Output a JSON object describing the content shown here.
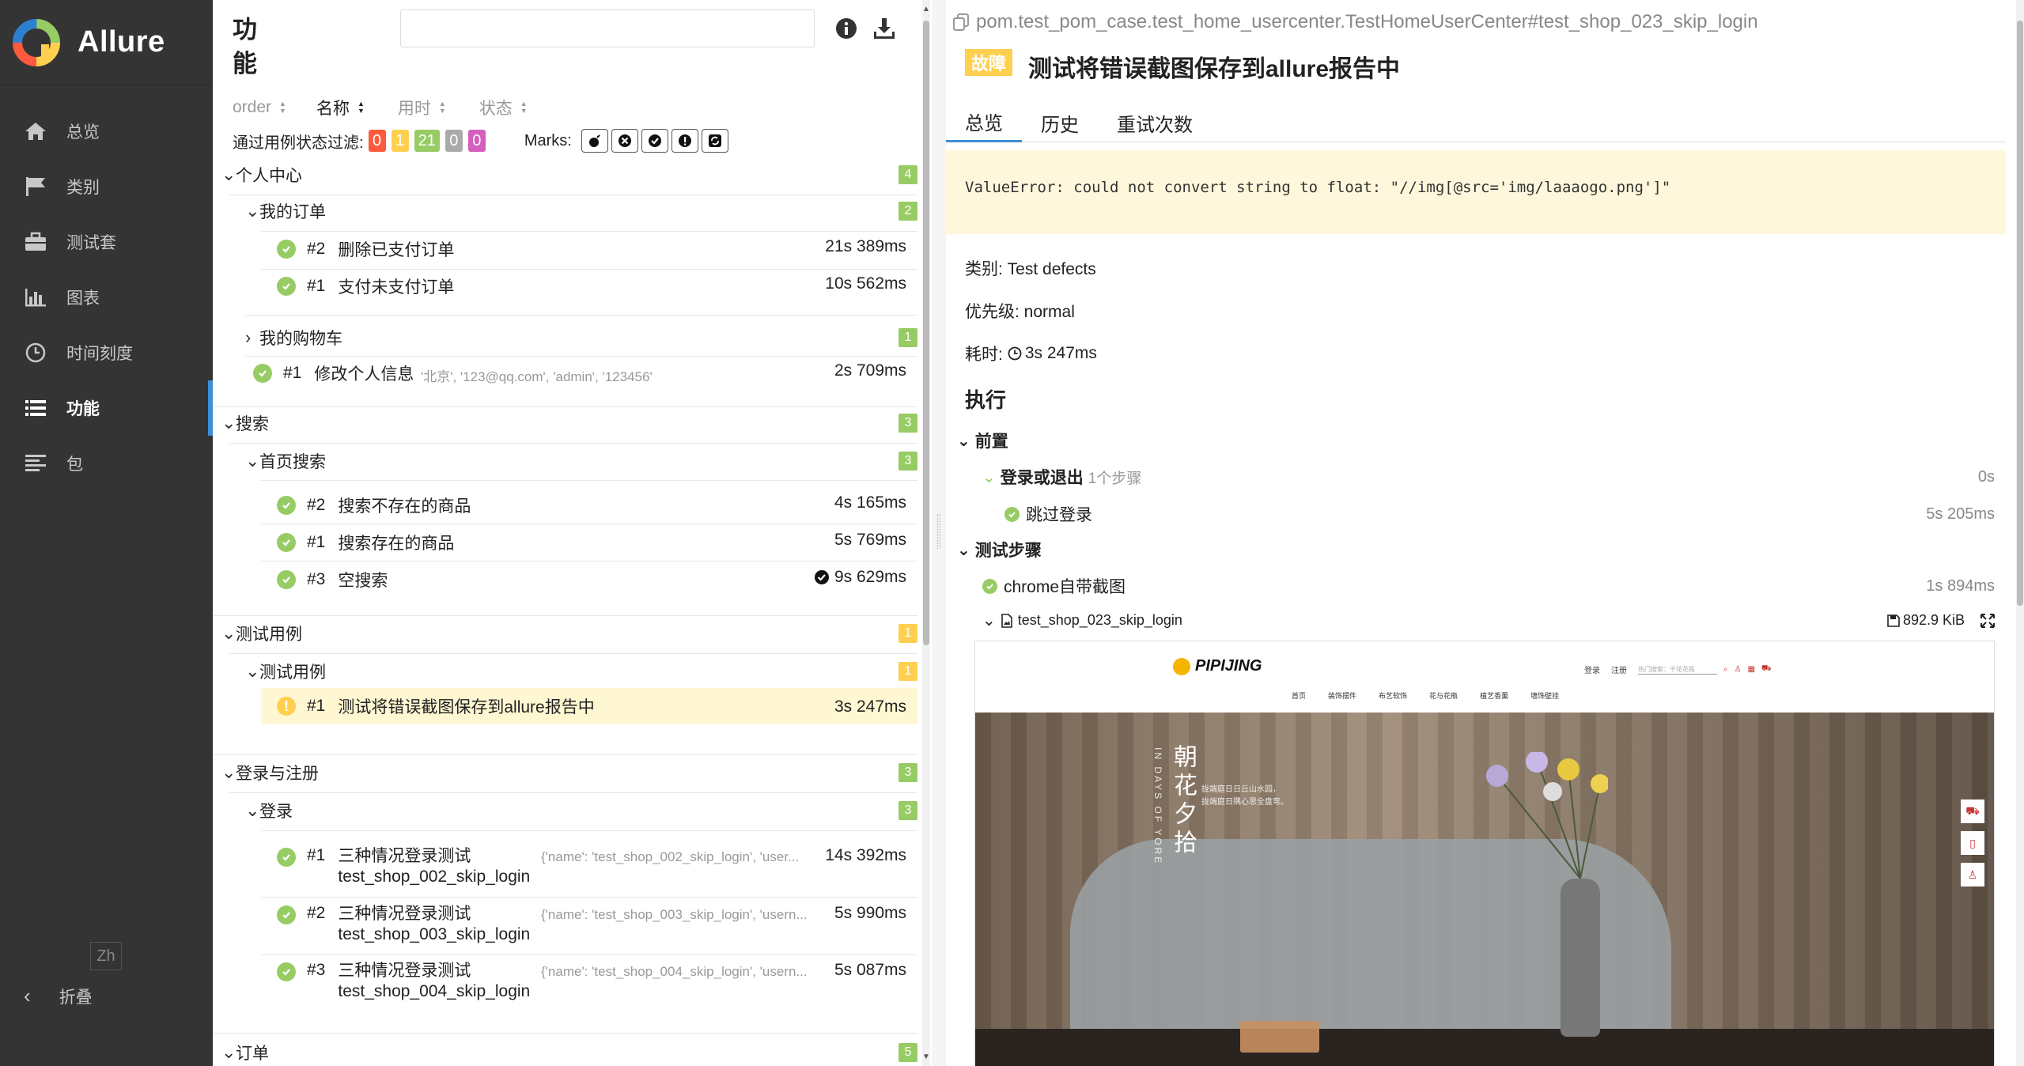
{
  "app": {
    "name": "Allure",
    "brand_colors": [
      "#97cc64",
      "#ffd050",
      "#fd5a3e",
      "#2f7fd0"
    ]
  },
  "sidebar": {
    "items": [
      {
        "label": "总览",
        "icon": "home-icon"
      },
      {
        "label": "类别",
        "icon": "flag-icon"
      },
      {
        "label": "测试套",
        "icon": "briefcase-icon"
      },
      {
        "label": "图表",
        "icon": "bar-chart-icon"
      },
      {
        "label": "时间刻度",
        "icon": "clock-icon"
      },
      {
        "label": "功能",
        "icon": "list-icon",
        "active": true
      },
      {
        "label": "包",
        "icon": "align-left-icon"
      }
    ],
    "lang": "Zh",
    "collapse": "折叠"
  },
  "mid": {
    "title": "功能",
    "sort": {
      "order": "order",
      "name": "名称",
      "duration": "用时",
      "status": "状态"
    },
    "filter": {
      "label": "通过用例状态过滤:",
      "counts": [
        {
          "value": "0",
          "color": "#fd5a3e"
        },
        {
          "value": "1",
          "color": "#ffd050"
        },
        {
          "value": "21",
          "color": "#97cc64"
        },
        {
          "value": "0",
          "color": "#aaaaaa"
        },
        {
          "value": "0",
          "color": "#d35ebe"
        }
      ],
      "marks_label": "Marks:"
    },
    "tree": [
      {
        "kind": "group",
        "level": 0,
        "label": "个人中心",
        "count": "4",
        "open": true
      },
      {
        "kind": "group",
        "level": 1,
        "label": "我的订单",
        "count": "2",
        "open": true
      },
      {
        "kind": "case",
        "level": 2,
        "num": "#2",
        "name": "删除已支付订单",
        "duration": "21s 389ms",
        "status": "passed"
      },
      {
        "kind": "case",
        "level": 2,
        "num": "#1",
        "name": "支付未支付订单",
        "duration": "10s 562ms",
        "status": "passed"
      },
      {
        "kind": "group",
        "level": 1,
        "label": "我的购物车",
        "count": "1",
        "open": false
      },
      {
        "kind": "case",
        "level": 1,
        "num": "#1",
        "name": "修改个人信息",
        "params": "'北京', '123@qq.com', 'admin', '123456'",
        "duration": "2s 709ms",
        "status": "passed"
      },
      {
        "kind": "group",
        "level": 0,
        "label": "搜索",
        "count": "3",
        "open": true
      },
      {
        "kind": "group",
        "level": 1,
        "label": "首页搜索",
        "count": "3",
        "open": true
      },
      {
        "kind": "case",
        "level": 2,
        "num": "#2",
        "name": "搜索不存在的商品",
        "duration": "4s 165ms",
        "status": "passed"
      },
      {
        "kind": "case",
        "level": 2,
        "num": "#1",
        "name": "搜索存在的商品",
        "duration": "5s 769ms",
        "status": "passed"
      },
      {
        "kind": "case",
        "level": 2,
        "num": "#3",
        "name": "空搜索",
        "duration": "9s 629ms",
        "status": "passed",
        "flag": true
      },
      {
        "kind": "group",
        "level": 0,
        "label": "测试用例",
        "count": "1",
        "open": true,
        "warn": true
      },
      {
        "kind": "group",
        "level": 1,
        "label": "测试用例",
        "count": "1",
        "open": true,
        "warn": true
      },
      {
        "kind": "case",
        "level": 2,
        "num": "#1",
        "name": "测试将错误截图保存到allure报告中",
        "duration": "3s 247ms",
        "status": "broken",
        "selected": true
      },
      {
        "kind": "group",
        "level": 0,
        "label": "登录与注册",
        "count": "3",
        "open": true
      },
      {
        "kind": "group",
        "level": 1,
        "label": "登录",
        "count": "3",
        "open": true
      },
      {
        "kind": "case",
        "level": 2,
        "num": "#1",
        "name": "三种情况登录测试",
        "name2": "test_shop_002_skip_login",
        "params": "{'name': 'test_shop_002_skip_login', 'user...",
        "duration": "14s 392ms",
        "status": "passed"
      },
      {
        "kind": "case",
        "level": 2,
        "num": "#2",
        "name": "三种情况登录测试",
        "name2": "test_shop_003_skip_login",
        "params": "{'name': 'test_shop_003_skip_login', 'usern...",
        "duration": "5s 990ms",
        "status": "passed"
      },
      {
        "kind": "case",
        "level": 2,
        "num": "#3",
        "name": "三种情况登录测试",
        "name2": "test_shop_004_skip_login",
        "params": "{'name': 'test_shop_004_skip_login', 'usern...",
        "duration": "5s 087ms",
        "status": "passed"
      },
      {
        "kind": "group",
        "level": 0,
        "label": "订单",
        "count": "5",
        "open": true
      }
    ]
  },
  "detail": {
    "path": "pom.test_pom_case.test_home_usercenter.TestHomeUserCenter#test_shop_023_skip_login",
    "status_tag": "故障",
    "title": "测试将错误截图保存到allure报告中",
    "tabs": [
      "总览",
      "历史",
      "重试次数"
    ],
    "error": "ValueError: could not convert string to float: \"//img[@src='img/laaaogo.png']\"",
    "category": "类别: Test defects",
    "severity": "优先级: normal",
    "duration_label": "耗时:",
    "duration": "3s 247ms",
    "exec_title": "执行",
    "setup_label": "前置",
    "setup_step": {
      "name": "登录或退出",
      "substeps": "1个步骤",
      "duration": "0s"
    },
    "setup_substep": {
      "name": "跳过登录",
      "duration": "5s 205ms"
    },
    "steps_label": "测试步骤",
    "step1": {
      "name": "chrome自带截图",
      "duration": "1s 894ms"
    },
    "attachment": {
      "name": "test_shop_023_skip_login",
      "size": "892.9 KiB"
    },
    "screenshot": {
      "brand": "PIPIJING",
      "nav_right": [
        "登录",
        "注册"
      ],
      "search_placeholder": "热门搜索：干花花瓶",
      "menu": [
        "首页",
        "装饰摆件",
        "布艺软饰",
        "花与花瓶",
        "植艺香薰",
        "墙饰壁挂"
      ],
      "banner_title": "朝花夕拾",
      "banner_sub": "IN DAYS OF YORE",
      "banner_lines": [
        "拢端庭日日丘山水园，",
        "拢端庭日隅心思全盘弯。"
      ]
    }
  }
}
